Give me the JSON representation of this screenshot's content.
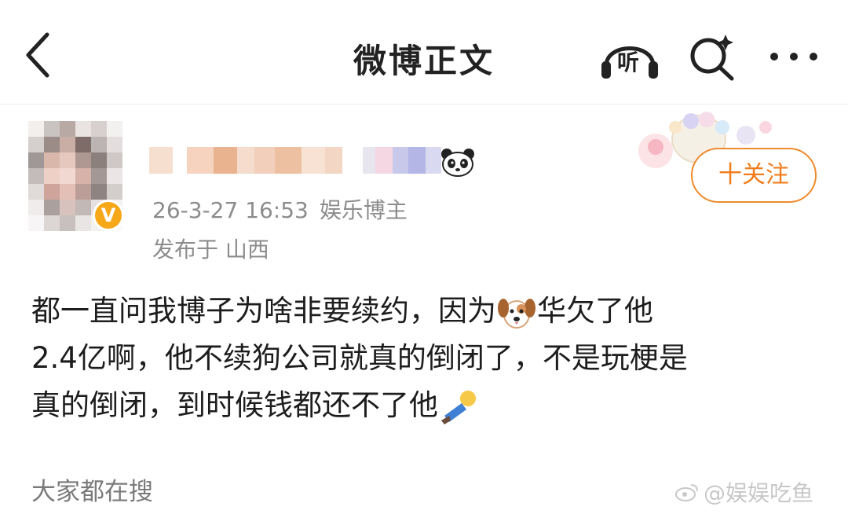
{
  "header": {
    "title": "微博正文",
    "back_icon": "chevron-left-icon",
    "listen_label": "听",
    "search_icon": "search-sparkle-icon",
    "more_icon": "more-dots-icon"
  },
  "post": {
    "timestamp": "26-3-27 16:53",
    "user_tag": "娱乐博主",
    "location": "发布于 山西",
    "follow_label": "十关注",
    "content": {
      "line1_a": "都一直问我博子为啥非要续约，因为",
      "line1_b": "华欠了他",
      "line2": "2.4亿啊，他不续狗公司就真的倒闭了，不是玩梗是",
      "line3": "真的倒闭，到时候钱都还不了他"
    }
  },
  "footer": {
    "hot_search_label": "大家都在搜",
    "watermark": "@娱娱吃鱼"
  },
  "colors": {
    "accent": "#f07c1a",
    "verified_badge": "#f7a818",
    "meta_text": "#8c8c8c"
  }
}
